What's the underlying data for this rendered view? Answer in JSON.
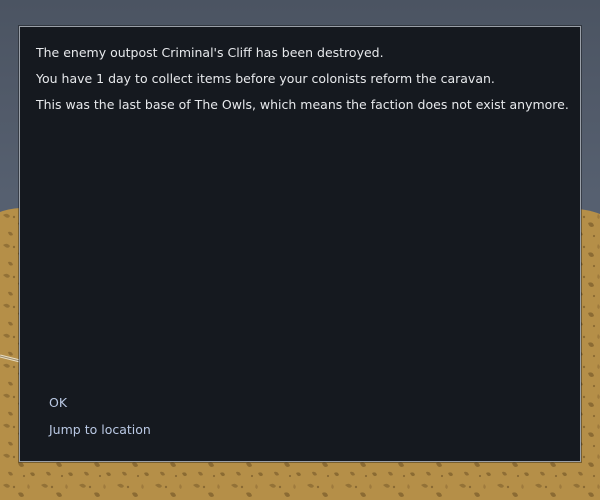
{
  "dialog": {
    "messages": [
      "The enemy outpost Criminal's Cliff has been destroyed.",
      "You have 1 day to collect items before your colonists reform the caravan.",
      "This was the last base of The Owls, which means the faction does not exist anymore."
    ],
    "options": {
      "ok": "OK",
      "jump": "Jump to location"
    }
  },
  "colors": {
    "dialog_background": "#15191f",
    "dialog_border": "#9aa0a8",
    "text": "#e7e9ec",
    "option_text": "#b9c8e3",
    "sky": "#565f6e",
    "terrain": "#b8924a"
  }
}
